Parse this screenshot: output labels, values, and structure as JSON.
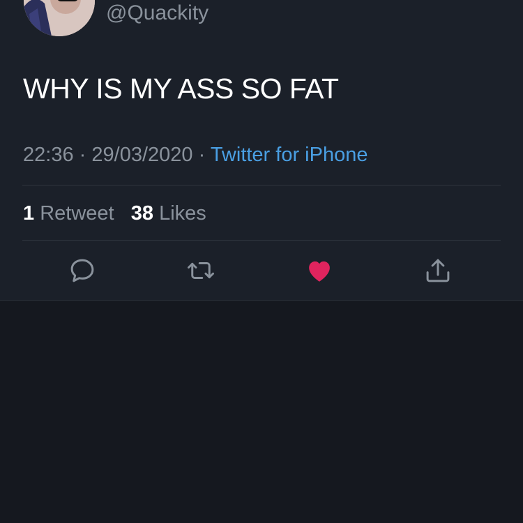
{
  "tweet": {
    "handle": "@Quackity",
    "text": "WHY IS MY ASS SO FAT",
    "time": "22:36",
    "separator": "·",
    "date": "29/03/2020",
    "source": "Twitter for iPhone"
  },
  "stats": {
    "retweets_count": "1",
    "retweets_label": "Retweet",
    "likes_count": "38",
    "likes_label": "Likes"
  },
  "actions": {
    "reply_icon": "reply-icon",
    "retweet_icon": "retweet-icon",
    "like_icon": "heart-icon",
    "share_icon": "share-icon",
    "liked": true
  },
  "colors": {
    "background": "#15181f",
    "card": "#1b2029",
    "text": "#ffffff",
    "muted": "#8a929c",
    "link": "#4a9fe3",
    "like": "#e0245e"
  }
}
